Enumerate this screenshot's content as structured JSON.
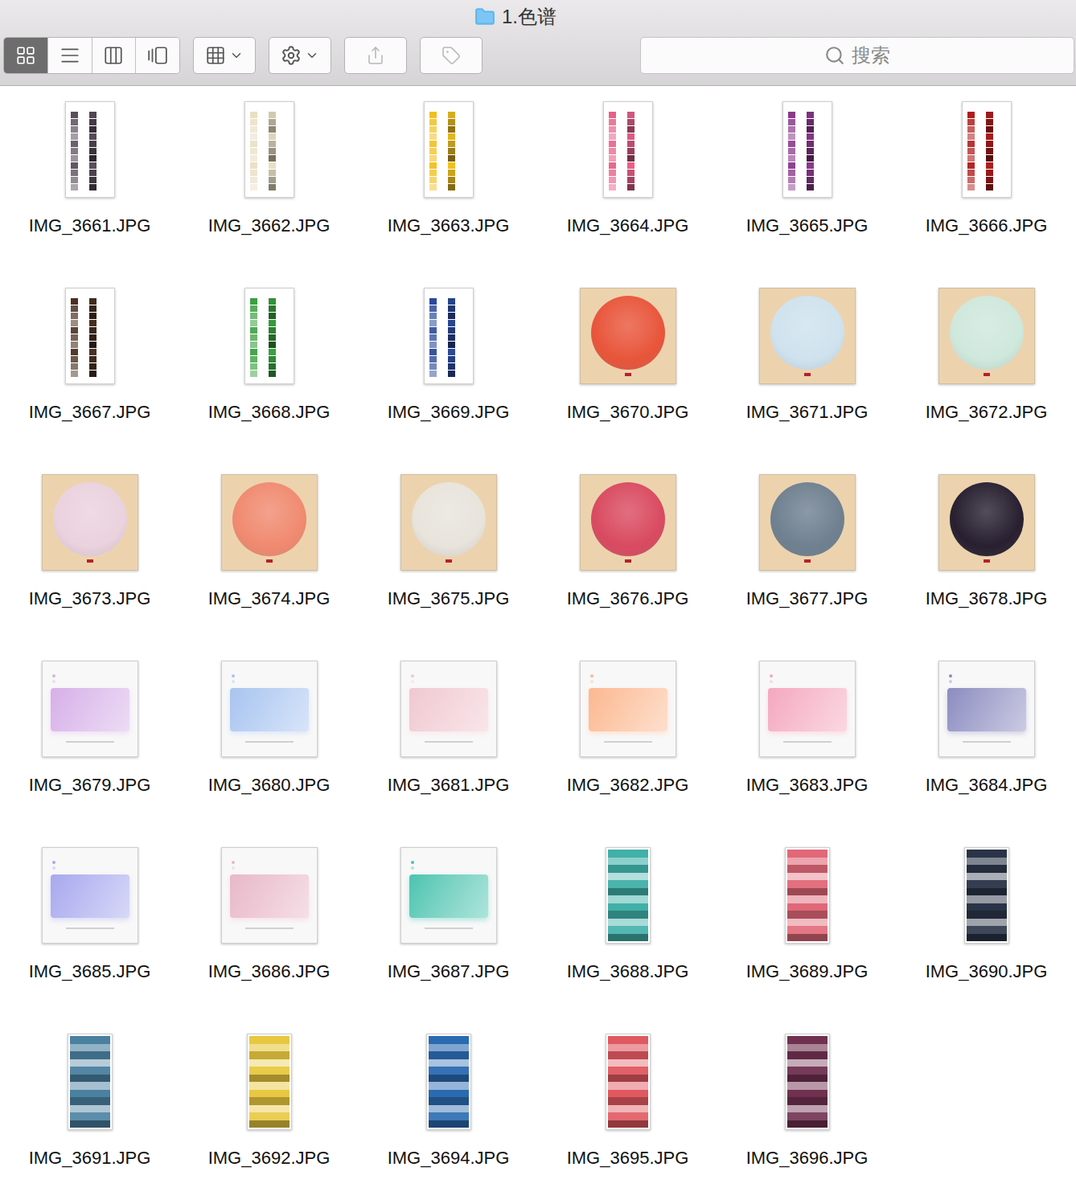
{
  "window": {
    "title": "1.色谱"
  },
  "view_modes": [
    {
      "selected": true
    },
    {
      "selected": false
    },
    {
      "selected": false
    },
    {
      "selected": false
    }
  ],
  "search": {
    "placeholder": "搜索"
  },
  "files": [
    {
      "name": "IMG_3661.JPG",
      "kind": "chart",
      "color": "#5a4e5c"
    },
    {
      "name": "IMG_3662.JPG",
      "kind": "chart",
      "color": "#eadfc4"
    },
    {
      "name": "IMG_3663.JPG",
      "kind": "chart",
      "color": "#f0c020"
    },
    {
      "name": "IMG_3664.JPG",
      "kind": "chart",
      "color": "#e8608a"
    },
    {
      "name": "IMG_3665.JPG",
      "kind": "chart",
      "color": "#8a3a8a"
    },
    {
      "name": "IMG_3666.JPG",
      "kind": "chart",
      "color": "#b01c1c"
    },
    {
      "name": "IMG_3667.JPG",
      "kind": "chart",
      "color": "#4a3020"
    },
    {
      "name": "IMG_3668.JPG",
      "kind": "chart",
      "color": "#3aa040"
    },
    {
      "name": "IMG_3669.JPG",
      "kind": "chart",
      "color": "#2a4a9a"
    },
    {
      "name": "IMG_3670.JPG",
      "kind": "painting",
      "color": "#e8553a"
    },
    {
      "name": "IMG_3671.JPG",
      "kind": "painting",
      "color": "#cfe2ee"
    },
    {
      "name": "IMG_3672.JPG",
      "kind": "painting",
      "color": "#cfe8dc"
    },
    {
      "name": "IMG_3673.JPG",
      "kind": "painting",
      "color": "#ead2de"
    },
    {
      "name": "IMG_3674.JPG",
      "kind": "painting",
      "color": "#f08a70"
    },
    {
      "name": "IMG_3675.JPG",
      "kind": "painting",
      "color": "#e8e4dc"
    },
    {
      "name": "IMG_3676.JPG",
      "kind": "painting",
      "color": "#d94a60"
    },
    {
      "name": "IMG_3677.JPG",
      "kind": "painting",
      "color": "#6f8090"
    },
    {
      "name": "IMG_3678.JPG",
      "kind": "painting",
      "color": "#282030"
    },
    {
      "name": "IMG_3679.JPG",
      "kind": "gradient",
      "color": "#d6b0e8"
    },
    {
      "name": "IMG_3680.JPG",
      "kind": "gradient",
      "color": "#a8c4f0"
    },
    {
      "name": "IMG_3681.JPG",
      "kind": "gradient",
      "color": "#f0c8d0"
    },
    {
      "name": "IMG_3682.JPG",
      "kind": "gradient",
      "color": "#fbb890"
    },
    {
      "name": "IMG_3683.JPG",
      "kind": "gradient",
      "color": "#f4a8c0"
    },
    {
      "name": "IMG_3684.JPG",
      "kind": "gradient",
      "color": "#8c8cc0"
    },
    {
      "name": "IMG_3685.JPG",
      "kind": "gradient",
      "color": "#a8a8ee"
    },
    {
      "name": "IMG_3686.JPG",
      "kind": "gradient",
      "color": "#e8b8c8"
    },
    {
      "name": "IMG_3687.JPG",
      "kind": "gradient",
      "color": "#48c4b0"
    },
    {
      "name": "IMG_3688.JPG",
      "kind": "strip",
      "color": "#40b0a8"
    },
    {
      "name": "IMG_3689.JPG",
      "kind": "strip",
      "color": "#e06878"
    },
    {
      "name": "IMG_3690.JPG",
      "kind": "strip",
      "color": "#2a3448"
    },
    {
      "name": "IMG_3691.JPG",
      "kind": "strip",
      "color": "#4a80a0"
    },
    {
      "name": "IMG_3692.JPG",
      "kind": "strip",
      "color": "#e8c840"
    },
    {
      "name": "IMG_3694.JPG",
      "kind": "strip",
      "color": "#2a6ab0"
    },
    {
      "name": "IMG_3695.JPG",
      "kind": "strip",
      "color": "#e05860"
    },
    {
      "name": "IMG_3696.JPG",
      "kind": "strip",
      "color": "#703050"
    }
  ]
}
